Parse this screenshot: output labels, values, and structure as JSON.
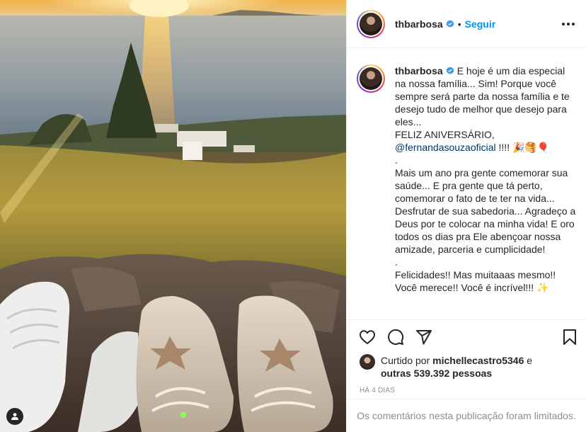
{
  "post": {
    "username": "thbarbosa",
    "separator": "•",
    "follow_label": "Seguir",
    "caption_parts": {
      "intro": "E hoje é um dia especial na nossa família... Sim! Porque você sempre será parte da nossa família e te desejo tudo de melhor que desejo para eles...\nFELIZ ANIVERSÁRIO,\n",
      "mention": "@fernandasouzaoficial",
      "after_mention": " !!!! 🎉🥞🎈\n.\nMais um ano pra gente comemorar sua saúde... E pra gente que tá perto, comemorar o fato de te ter na vida... Desfrutar de sua sabedoria... Agradeço a Deus por te colocar na minha vida! E oro todos os dias pra Ele abençoar nossa amizade, parceria e cumplicidade!\n.\nFelicidades!! Mas muitaaas mesmo!! Você merece!! Você é incrível!!! ✨"
    },
    "likes": {
      "prefix": "Curtido por ",
      "liker": "michellecastro5346",
      "middle": " e ",
      "others": "outras 539.392 pessoas"
    },
    "time_ago": "HÁ 4 DIAS",
    "comments_limited": "Os comentários nesta publicação foram limitados."
  },
  "icons": {
    "more": "more-options-icon",
    "verified": "verified-badge-icon",
    "like": "heart-icon",
    "comment": "comment-icon",
    "share": "share-icon",
    "save": "bookmark-icon",
    "tags": "user-tag-icon"
  },
  "colors": {
    "follow_blue": "#0095f6",
    "verified_blue": "#3897f0",
    "mention_blue": "#00376b",
    "muted_gray": "#8e8e8e",
    "text": "#262626"
  }
}
